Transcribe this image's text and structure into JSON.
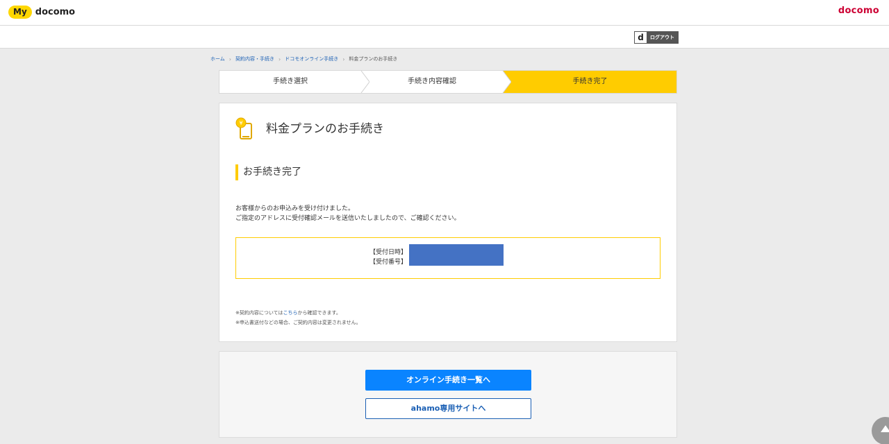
{
  "header": {
    "logo_my": "My",
    "logo_docomo": "docomo",
    "brand": "docomo"
  },
  "subbar": {
    "logout_d": "d",
    "logout_label": "ログアウト"
  },
  "breadcrumb": {
    "items": [
      "ホーム",
      "契約内容・手続き",
      "ドコモオンライン手続き"
    ],
    "current": "料金プランのお手続き"
  },
  "steps": [
    {
      "label": "手続き選択",
      "active": false
    },
    {
      "label": "手続き内容確認",
      "active": false
    },
    {
      "label": "手続き完了",
      "active": true
    }
  ],
  "main": {
    "title": "料金プランのお手続き",
    "section_title": "お手続き完了",
    "message_line1": "お客様からのお申込みを受け付けました。",
    "message_line2": "ご指定のアドレスに受付確認メールを送信いたしましたので、ご確認ください。",
    "info_label_date": "【受付日時】",
    "info_label_number": "【受付番号】",
    "note1_prefix": "※契約内容については",
    "note1_link": "こちら",
    "note1_suffix": "から確認できます。",
    "note2": "※申込書送付などの場合、ご契約内容は変更されません。"
  },
  "actions": {
    "primary_label": "オンライン手続き一覧へ",
    "secondary_label": "ahamo専用サイトへ"
  },
  "colors": {
    "accent": "#ffcc00",
    "link": "#1a5fb4",
    "button": "#0a84ff",
    "brand": "#cc0033",
    "redaction": "#4472c4"
  },
  "icons": {
    "plan": "phone-yen-icon",
    "pagetop": "arrow-up-icon",
    "breadcrumb_separator": "chevron-right-icon"
  }
}
